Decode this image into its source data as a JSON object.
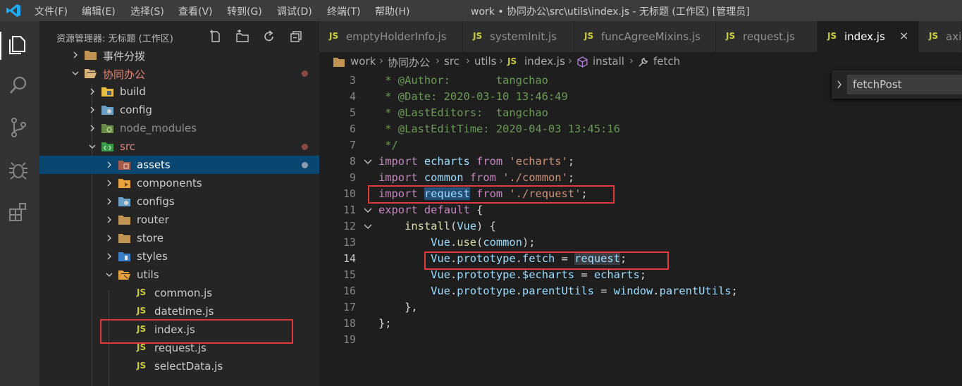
{
  "titlebar": {
    "menu": [
      "文件(F)",
      "编辑(E)",
      "选择(S)",
      "查看(V)",
      "转到(G)",
      "调试(D)",
      "终端(T)",
      "帮助(H)"
    ],
    "window_title": "work • 协同办公\\src\\utils\\index.js - 无标题 (工作区) [管理员]"
  },
  "activity": [
    "explorer-icon",
    "search-icon",
    "source-control-icon",
    "debug-icon",
    "extensions-icon"
  ],
  "sidebar": {
    "header": "资源管理器: 无标题 (工作区)",
    "actions": [
      "new-file-icon",
      "new-folder-icon",
      "refresh-icon",
      "collapse-all-icon"
    ],
    "tree": [
      {
        "label": "事件分拨",
        "type": "folder",
        "depth": 2,
        "expanded": false
      },
      {
        "label": "协同办公",
        "type": "folder",
        "depth": 1,
        "expanded": true,
        "modified": true
      },
      {
        "label": "build",
        "type": "folder",
        "depth": 2,
        "expanded": false
      },
      {
        "label": "config",
        "type": "folder",
        "depth": 2,
        "expanded": false
      },
      {
        "label": "node_modules",
        "type": "folder",
        "depth": 2,
        "expanded": false,
        "dim": true
      },
      {
        "label": "src",
        "type": "folder",
        "depth": 2,
        "expanded": true,
        "modified": true
      },
      {
        "label": "assets",
        "type": "folder",
        "depth": 3,
        "expanded": false,
        "selected": true
      },
      {
        "label": "components",
        "type": "folder",
        "depth": 3,
        "expanded": false
      },
      {
        "label": "configs",
        "type": "folder",
        "depth": 3,
        "expanded": false
      },
      {
        "label": "router",
        "type": "folder",
        "depth": 3,
        "expanded": false
      },
      {
        "label": "store",
        "type": "folder",
        "depth": 3,
        "expanded": false
      },
      {
        "label": "styles",
        "type": "folder",
        "depth": 3,
        "expanded": false
      },
      {
        "label": "utils",
        "type": "folder",
        "depth": 3,
        "expanded": true
      },
      {
        "label": "common.js",
        "type": "file",
        "depth": 4
      },
      {
        "label": "datetime.js",
        "type": "file",
        "depth": 4
      },
      {
        "label": "index.js",
        "type": "file",
        "depth": 4
      },
      {
        "label": "request.js",
        "type": "file",
        "depth": 4
      },
      {
        "label": "selectData.js",
        "type": "file",
        "depth": 4
      }
    ]
  },
  "tabs": [
    {
      "label": "emptyHolderInfo.js",
      "badge": "JS",
      "active": false
    },
    {
      "label": "systemInit.js",
      "badge": "JS",
      "active": false
    },
    {
      "label": "funcAgreeMixins.js",
      "badge": "JS",
      "active": false
    },
    {
      "label": "request.js",
      "badge": "JS",
      "active": false
    },
    {
      "label": "index.js",
      "badge": "JS",
      "active": true,
      "close": "×"
    },
    {
      "label": "axio",
      "badge": "JS",
      "active": false
    }
  ],
  "breadcrumb": {
    "items": [
      "work",
      "协同办公",
      "src",
      "utils",
      "index.js",
      "install",
      "fetch"
    ],
    "js_badge": "JS"
  },
  "editor": {
    "current_line": 14,
    "lines": [
      {
        "n": "3",
        "text": " * @Author:       tangchao"
      },
      {
        "n": "4",
        "text": " * @Date: 2020-03-10 13:46:49"
      },
      {
        "n": "5",
        "text": " * @LastEditors:  tangchao"
      },
      {
        "n": "6",
        "text": " * @LastEditTime: 2020-04-03 13:45:16"
      },
      {
        "n": "7",
        "text": " */"
      },
      {
        "n": "8",
        "text": "import echarts from 'echarts';"
      },
      {
        "n": "9",
        "text": "import common from './common';"
      },
      {
        "n": "10",
        "text": "import request from './request';"
      },
      {
        "n": "11",
        "text": "export default {"
      },
      {
        "n": "12",
        "text": "    install(Vue) {"
      },
      {
        "n": "13",
        "text": "        Vue.use(common);"
      },
      {
        "n": "14",
        "text": "        Vue.prototype.fetch = request;"
      },
      {
        "n": "15",
        "text": "        Vue.prototype.$echarts = echarts;"
      },
      {
        "n": "16",
        "text": "        Vue.prototype.parentUtils = window.parentUtils;"
      },
      {
        "n": "17",
        "text": "    },"
      },
      {
        "n": "18",
        "text": "};"
      },
      {
        "n": "19",
        "text": ""
      }
    ]
  },
  "find_widget": {
    "value": "fetchPost"
  },
  "colors": {
    "accent": "#007acc",
    "selection": "#094771",
    "annotation": "#e03a3a",
    "modified_dot": "#8a4a45"
  }
}
